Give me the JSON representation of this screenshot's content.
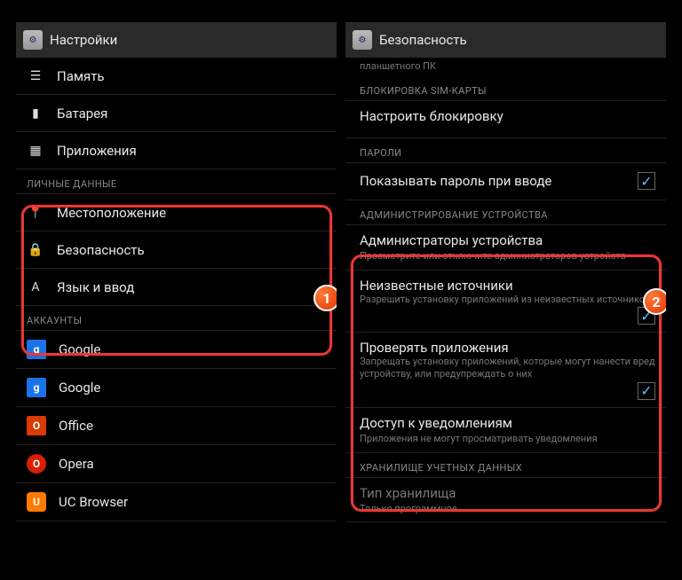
{
  "left": {
    "title": "Настройки",
    "items": [
      {
        "label": "Память"
      },
      {
        "label": "Батарея"
      },
      {
        "label": "Приложения"
      }
    ],
    "section_personal": "ЛИЧНЫЕ ДАННЫЕ",
    "personal": [
      {
        "label": "Местоположение"
      },
      {
        "label": "Безопасность"
      },
      {
        "label": "Язык и ввод"
      }
    ],
    "section_accounts": "АККАУНТЫ",
    "accounts": [
      {
        "label": "Google"
      },
      {
        "label": "Google"
      },
      {
        "label": "Office"
      },
      {
        "label": "Opera"
      },
      {
        "label": "UC Browser"
      }
    ],
    "badge": "1"
  },
  "right": {
    "title": "Безопасность",
    "sub0": "планшетного ПК",
    "section_sim": "БЛОКИРОВКА SIM-КАРТЫ",
    "sim_setup": "Настроить блокировку",
    "section_pass": "ПАРОЛИ",
    "show_pass": "Показывать пароль при вводе",
    "section_admin": "АДМИНИСТРИРОВАНИЕ УСТРОЙСТВА",
    "admin": [
      {
        "title": "Администраторы устройства",
        "sub": "Просмотрите или отключите администраторов устройств"
      },
      {
        "title": "Неизвестные источники",
        "sub": "Разрешить установку приложений из неизвестных источников",
        "checked": true
      },
      {
        "title": "Проверять приложения",
        "sub": "Запрещать установку приложений, которые могут нанести вред устройству, или предупреждать о них",
        "checked": true
      },
      {
        "title": "Доступ к уведомлениям",
        "sub": "Приложения не могут просматривать уведомления"
      }
    ],
    "section_storage": "ХРАНИЛИЩЕ УЧЕТНЫХ ДАННЫХ",
    "storage": {
      "title": "Тип хранилища",
      "sub": "Только программное"
    },
    "badge": "2"
  }
}
